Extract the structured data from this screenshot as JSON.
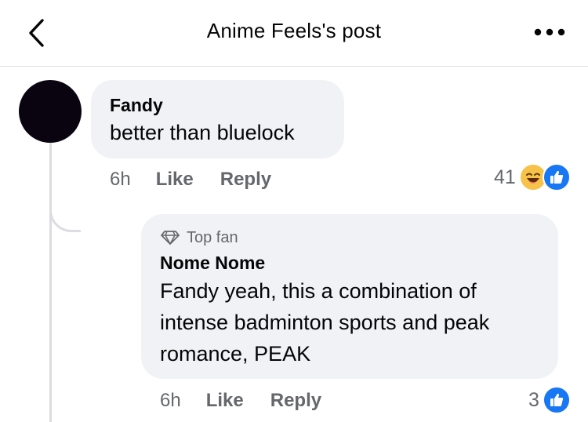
{
  "header": {
    "title": "Anime Feels's post",
    "back_icon": "chevron-left-icon",
    "more_icon": "more-horizontal-icon"
  },
  "comments": [
    {
      "author": "Fandy",
      "text": "better than bluelock",
      "time": "6h",
      "like_label": "Like",
      "reply_label": "Reply",
      "reaction_count": "41",
      "reactions": [
        "haha-reaction-icon",
        "like-reaction-icon"
      ]
    },
    {
      "badge": "Top fan",
      "badge_icon": "diamond-icon",
      "author": "Nome Nome",
      "text_lines": [
        "Fandy yeah, this a combination of",
        "intense badminton sports and peak",
        "romance, PEAK"
      ],
      "time": "6h",
      "like_label": "Like",
      "reply_label": "Reply",
      "reaction_count": "3",
      "reactions": [
        "like-reaction-icon"
      ]
    }
  ],
  "colors": {
    "bubble": "#f0f2f5",
    "meta_text": "#65676b",
    "like_blue": "#1877f2",
    "haha_yellow": "#f7c24a"
  }
}
